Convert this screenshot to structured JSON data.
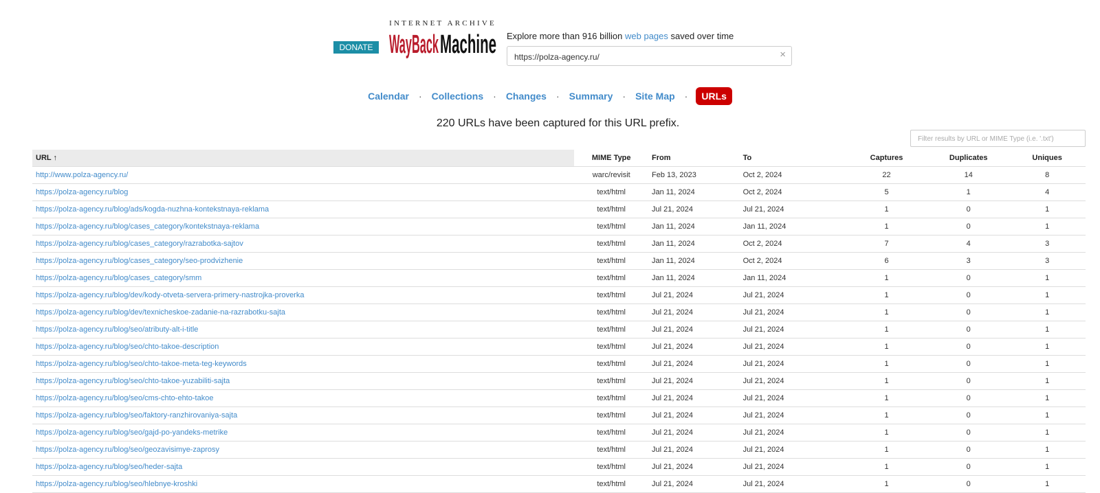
{
  "header": {
    "donate_label": "DONATE",
    "logo_ia": "INTERNET ARCHIVE",
    "logo_wayback": "WayBackMachine",
    "explore_prefix": "Explore more than 916 billion ",
    "explore_link": "web pages",
    "explore_suffix": " saved over time",
    "search_value": "https://polza-agency.ru/",
    "clear_icon": "×"
  },
  "nav": {
    "items": [
      "Calendar",
      "Collections",
      "Changes",
      "Summary",
      "Site Map",
      "URLs"
    ],
    "separator": "·",
    "active_index": 5
  },
  "summary_text": "220 URLs have been captured for this URL prefix.",
  "filter_placeholder": "Filter results by URL or MIME Type (i.e. '.txt')",
  "colors": {
    "link": "#428bca",
    "active": "#cc0000",
    "donate": "#1c8ea6"
  },
  "table": {
    "headers": {
      "url": "URL ↑",
      "mime": "MIME Type",
      "from": "From",
      "to": "To",
      "captures": "Captures",
      "duplicates": "Duplicates",
      "uniques": "Uniques"
    },
    "rows": [
      {
        "url": "http://www.polza-agency.ru/",
        "mime": "warc/revisit",
        "from": "Feb 13, 2023",
        "to": "Oct 2, 2024",
        "captures": "22",
        "duplicates": "14",
        "uniques": "8"
      },
      {
        "url": "https://polza-agency.ru/blog",
        "mime": "text/html",
        "from": "Jan 11, 2024",
        "to": "Oct 2, 2024",
        "captures": "5",
        "duplicates": "1",
        "uniques": "4"
      },
      {
        "url": "https://polza-agency.ru/blog/ads/kogda-nuzhna-kontekstnaya-reklama",
        "mime": "text/html",
        "from": "Jul 21, 2024",
        "to": "Jul 21, 2024",
        "captures": "1",
        "duplicates": "0",
        "uniques": "1"
      },
      {
        "url": "https://polza-agency.ru/blog/cases_category/kontekstnaya-reklama",
        "mime": "text/html",
        "from": "Jan 11, 2024",
        "to": "Jan 11, 2024",
        "captures": "1",
        "duplicates": "0",
        "uniques": "1"
      },
      {
        "url": "https://polza-agency.ru/blog/cases_category/razrabotka-sajtov",
        "mime": "text/html",
        "from": "Jan 11, 2024",
        "to": "Oct 2, 2024",
        "captures": "7",
        "duplicates": "4",
        "uniques": "3"
      },
      {
        "url": "https://polza-agency.ru/blog/cases_category/seo-prodvizhenie",
        "mime": "text/html",
        "from": "Jan 11, 2024",
        "to": "Oct 2, 2024",
        "captures": "6",
        "duplicates": "3",
        "uniques": "3"
      },
      {
        "url": "https://polza-agency.ru/blog/cases_category/smm",
        "mime": "text/html",
        "from": "Jan 11, 2024",
        "to": "Jan 11, 2024",
        "captures": "1",
        "duplicates": "0",
        "uniques": "1"
      },
      {
        "url": "https://polza-agency.ru/blog/dev/kody-otveta-servera-primery-nastrojka-proverka",
        "mime": "text/html",
        "from": "Jul 21, 2024",
        "to": "Jul 21, 2024",
        "captures": "1",
        "duplicates": "0",
        "uniques": "1"
      },
      {
        "url": "https://polza-agency.ru/blog/dev/texnicheskoe-zadanie-na-razrabotku-sajta",
        "mime": "text/html",
        "from": "Jul 21, 2024",
        "to": "Jul 21, 2024",
        "captures": "1",
        "duplicates": "0",
        "uniques": "1"
      },
      {
        "url": "https://polza-agency.ru/blog/seo/atributy-alt-i-title",
        "mime": "text/html",
        "from": "Jul 21, 2024",
        "to": "Jul 21, 2024",
        "captures": "1",
        "duplicates": "0",
        "uniques": "1"
      },
      {
        "url": "https://polza-agency.ru/blog/seo/chto-takoe-description",
        "mime": "text/html",
        "from": "Jul 21, 2024",
        "to": "Jul 21, 2024",
        "captures": "1",
        "duplicates": "0",
        "uniques": "1"
      },
      {
        "url": "https://polza-agency.ru/blog/seo/chto-takoe-meta-teg-keywords",
        "mime": "text/html",
        "from": "Jul 21, 2024",
        "to": "Jul 21, 2024",
        "captures": "1",
        "duplicates": "0",
        "uniques": "1"
      },
      {
        "url": "https://polza-agency.ru/blog/seo/chto-takoe-yuzabiliti-sajta",
        "mime": "text/html",
        "from": "Jul 21, 2024",
        "to": "Jul 21, 2024",
        "captures": "1",
        "duplicates": "0",
        "uniques": "1"
      },
      {
        "url": "https://polza-agency.ru/blog/seo/cms-chto-ehto-takoe",
        "mime": "text/html",
        "from": "Jul 21, 2024",
        "to": "Jul 21, 2024",
        "captures": "1",
        "duplicates": "0",
        "uniques": "1"
      },
      {
        "url": "https://polza-agency.ru/blog/seo/faktory-ranzhirovaniya-sajta",
        "mime": "text/html",
        "from": "Jul 21, 2024",
        "to": "Jul 21, 2024",
        "captures": "1",
        "duplicates": "0",
        "uniques": "1"
      },
      {
        "url": "https://polza-agency.ru/blog/seo/gajd-po-yandeks-metrike",
        "mime": "text/html",
        "from": "Jul 21, 2024",
        "to": "Jul 21, 2024",
        "captures": "1",
        "duplicates": "0",
        "uniques": "1"
      },
      {
        "url": "https://polza-agency.ru/blog/seo/geozavisimye-zaprosy",
        "mime": "text/html",
        "from": "Jul 21, 2024",
        "to": "Jul 21, 2024",
        "captures": "1",
        "duplicates": "0",
        "uniques": "1"
      },
      {
        "url": "https://polza-agency.ru/blog/seo/heder-sajta",
        "mime": "text/html",
        "from": "Jul 21, 2024",
        "to": "Jul 21, 2024",
        "captures": "1",
        "duplicates": "0",
        "uniques": "1"
      },
      {
        "url": "https://polza-agency.ru/blog/seo/hlebnye-kroshki",
        "mime": "text/html",
        "from": "Jul 21, 2024",
        "to": "Jul 21, 2024",
        "captures": "1",
        "duplicates": "0",
        "uniques": "1"
      }
    ]
  }
}
